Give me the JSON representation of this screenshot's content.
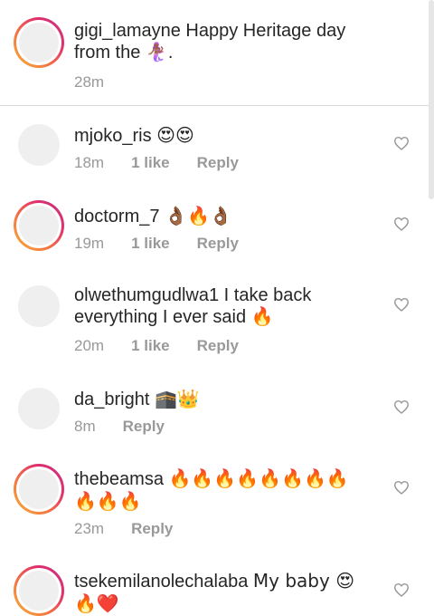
{
  "caption": {
    "username": "gigi_lamayne",
    "text": "Happy Heritage day from the 🧜🏾‍♀️.",
    "time": "28m"
  },
  "comments": [
    {
      "username": "mjoko_ris",
      "text": "😍😍",
      "time": "18m",
      "likes": "1 like",
      "reply": "Reply",
      "story_ring": false
    },
    {
      "username": "doctorm_7",
      "text": "👌🏾🔥👌🏾",
      "time": "19m",
      "likes": "1 like",
      "reply": "Reply",
      "story_ring": true
    },
    {
      "username": "olwethumgudlwa1",
      "text": "I take back everything I ever said 🔥",
      "time": "20m",
      "likes": "1 like",
      "reply": "Reply",
      "story_ring": false
    },
    {
      "username": "da_bright",
      "text": "🕋👑",
      "time": "8m",
      "likes": "",
      "reply": "Reply",
      "story_ring": false
    },
    {
      "username": "thebeamsa",
      "text": "🔥🔥🔥🔥🔥🔥🔥🔥🔥🔥🔥",
      "time": "23m",
      "likes": "",
      "reply": "Reply",
      "story_ring": true
    },
    {
      "username": "tsekemilanolechalaba",
      "text": "My baby 😍🔥❤️",
      "time": "",
      "likes": "",
      "reply": "",
      "story_ring": true
    }
  ],
  "icons": {
    "like": "heart-outline-icon"
  },
  "colors": {
    "text": "#262626",
    "meta": "#999999",
    "divider": "#dbdbdb",
    "heart": "#999999",
    "story_gradient": [
      "#f9b233",
      "#e1306c",
      "#c13584"
    ]
  }
}
